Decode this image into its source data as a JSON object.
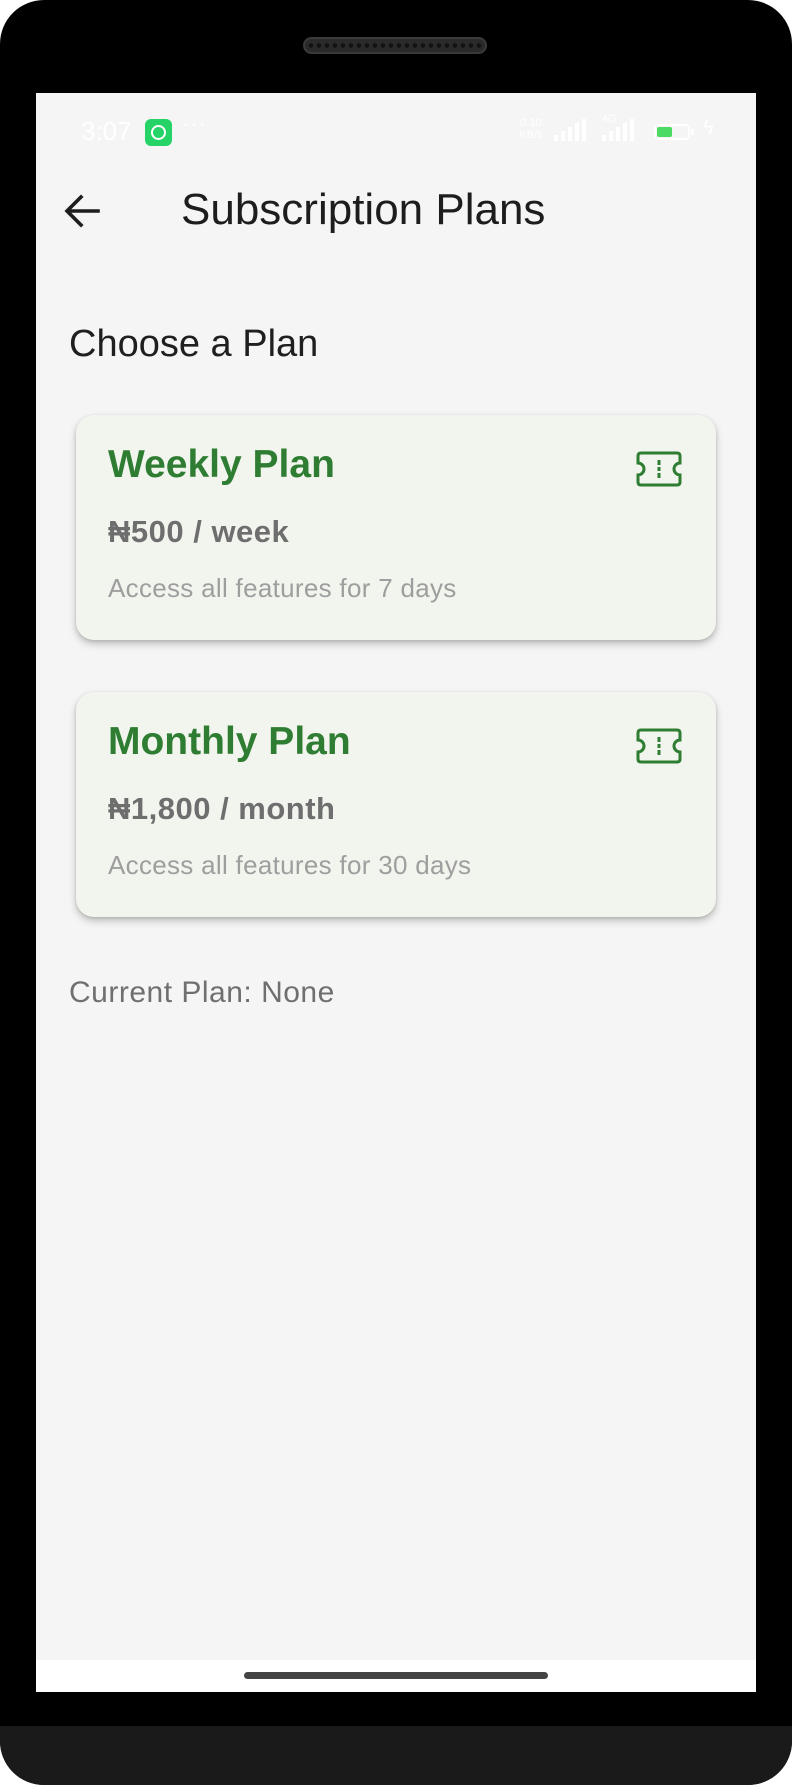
{
  "status_bar": {
    "time": "3:07",
    "more": "···",
    "net_speed_value": "0.10",
    "net_speed_unit": "KB/s",
    "network_type": "4G",
    "battery_level": "51",
    "battery_fill_fraction": 0.5
  },
  "app_bar": {
    "title": "Subscription Plans"
  },
  "main": {
    "heading": "Choose a Plan",
    "plans": [
      {
        "name": "Weekly Plan",
        "price": "₦500 / week",
        "description": "Access all features for 7 days",
        "icon": "ticket-icon"
      },
      {
        "name": "Monthly Plan",
        "price": "₦1,800 / month",
        "description": "Access all features for 30 days",
        "icon": "ticket-icon"
      }
    ],
    "current_plan": "Current Plan: None"
  },
  "colors": {
    "accent_green": "#2e7d32",
    "card_background": "#f2f5ee",
    "screen_background": "#f5f5f5"
  }
}
